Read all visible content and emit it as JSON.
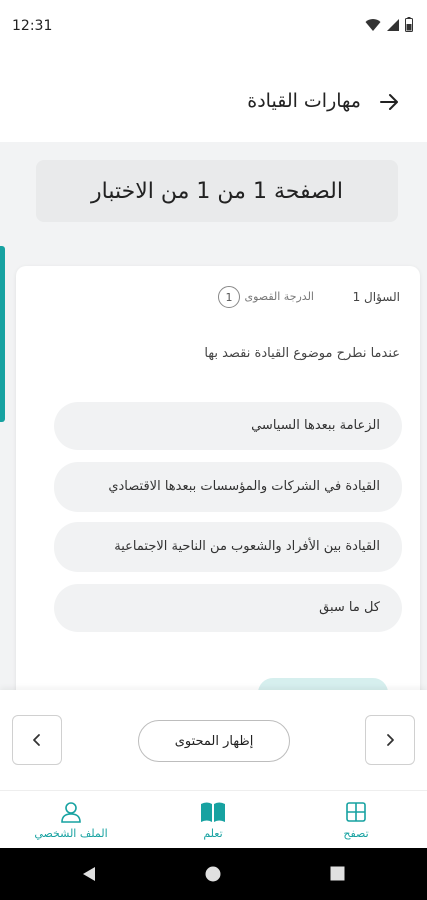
{
  "status_bar": {
    "time": "12:31"
  },
  "header": {
    "title": "مهارات القيادة"
  },
  "page_banner": {
    "text": "الصفحة 1 من 1 من الاختبار"
  },
  "question": {
    "number_label": "السؤال 1",
    "max_grade_label": "الدرجة القصوى",
    "max_grade_value": "1",
    "text": "عندما نطرح موضوع القيادة نقصد بها",
    "options": [
      "الزعامة ببعدها السياسي",
      "القيادة في الشركات والمؤسسات ببعدها الاقتصادي",
      "القيادة بين الأفراد والشعوب من الناحية الاجتماعية",
      "كل ما سبق"
    ]
  },
  "controls": {
    "show_content_label": "إظهار المحتوى"
  },
  "bottom_nav": {
    "tabs": [
      {
        "label": "تصفح",
        "icon": "grid-icon",
        "active": false
      },
      {
        "label": "تعلم",
        "icon": "book-icon",
        "active": true
      },
      {
        "label": "الملف الشخصي",
        "icon": "profile-icon",
        "active": false
      }
    ]
  },
  "colors": {
    "accent": "#17a2a1",
    "accent_light": "#d6efee"
  }
}
